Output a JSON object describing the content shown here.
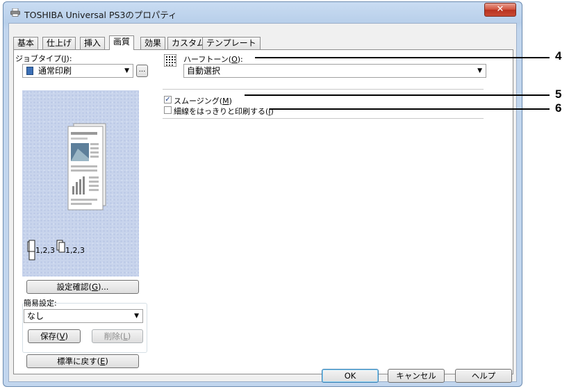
{
  "window": {
    "title": "TOSHIBA Universal PS3のプロパティ",
    "close_glyph": "✕"
  },
  "tabs": [
    {
      "label": "基本"
    },
    {
      "label": "仕上げ"
    },
    {
      "label": "挿入"
    },
    {
      "label": "画質",
      "active": true
    },
    {
      "label": "効果"
    },
    {
      "label": "カスタム"
    },
    {
      "label": "テンプレート"
    }
  ],
  "left": {
    "job_type": {
      "label": "ジョブタイプ(",
      "hotkey": "J",
      "label_end": "):",
      "value": "通常印刷",
      "more_button": "..."
    },
    "preview": {
      "copies_text_1": "1,2,3",
      "copies_text_2": "1,2,3"
    },
    "confirm_button": {
      "label": "設定確認(",
      "hotkey": "G",
      "label_end": ")..."
    },
    "quick_setting": {
      "label": "簡易設定:",
      "value": "なし",
      "save_button": {
        "label": "保存(",
        "hotkey": "V",
        "label_end": ")"
      },
      "delete_button": {
        "label": "削除(",
        "hotkey": "L",
        "label_end": ")"
      }
    },
    "restore_button": {
      "label": "標準に戻す(",
      "hotkey": "E",
      "label_end": ")"
    }
  },
  "right": {
    "halftone": {
      "label": "ハーフトーン(",
      "hotkey": "O",
      "label_end": "):",
      "value": "自動選択"
    },
    "smoothing": {
      "label": "スムージング(",
      "hotkey": "M",
      "label_end": ")",
      "checked": true
    },
    "fine_lines": {
      "label": "細線をはっきりと印刷する(",
      "hotkey": "I",
      "label_end": ")",
      "checked": false
    }
  },
  "footer": {
    "ok": "OK",
    "cancel": "キャンセル",
    "help": "ヘルプ"
  },
  "callouts": [
    "4",
    "5",
    "6"
  ],
  "colors": {
    "titlebar": "#c2d6ee",
    "close_button": "#c84a34",
    "preview_bg": "#c8d4ec",
    "default_button_border": "#3c7fb1"
  }
}
